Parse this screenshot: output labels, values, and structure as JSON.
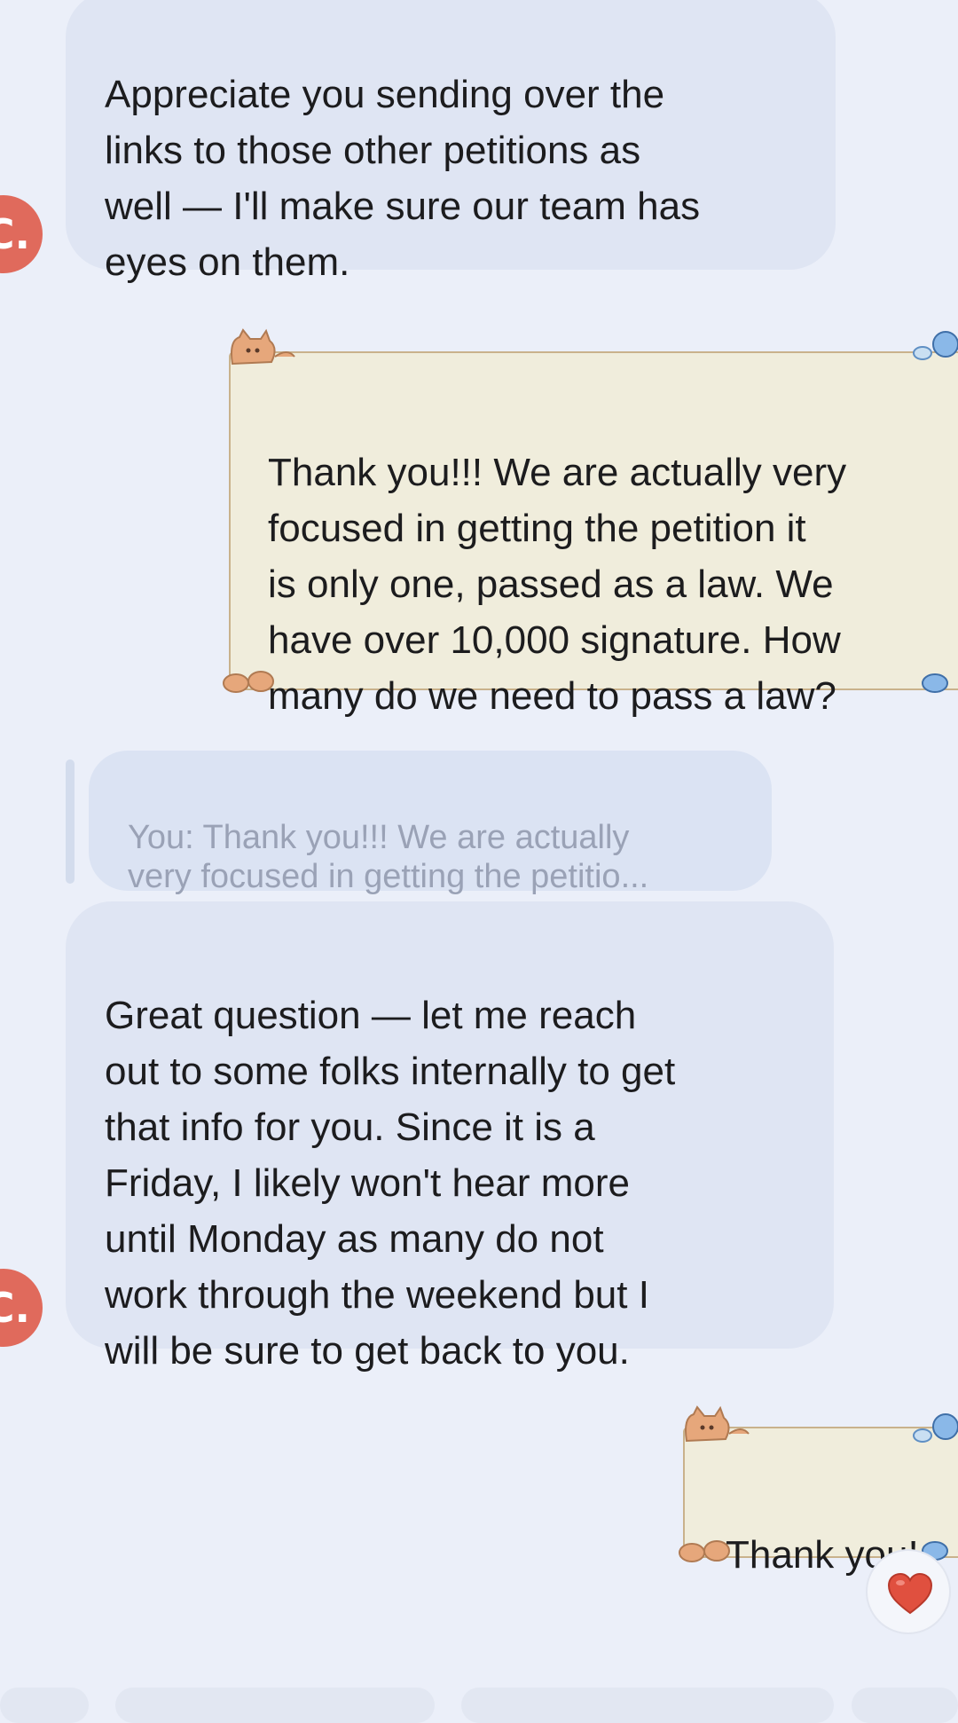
{
  "colors": {
    "background": "#ebeff9",
    "incoming_bubble": "#dfe5f3",
    "outgoing_bubble": "#f0eddc",
    "outgoing_border": "#c9b28c",
    "avatar": "#e06a5c",
    "quote_text": "#9aa2b6",
    "heart": "#e0503f"
  },
  "messages": [
    {
      "direction": "incoming",
      "avatar_letter": "C.",
      "text": "Appreciate you sending over the\nlinks to those other petitions as\nwell — I'll make sure our team has\neyes on them."
    },
    {
      "direction": "outgoing",
      "theme": "cat-sticker-frame",
      "text": "Thank you!!! We are actually very\nfocused in getting the petition it\nis only one, passed as a law. We\nhave over 10,000 signature. How\nmany do we need to pass a law?"
    },
    {
      "direction": "incoming",
      "avatar_letter": "C.",
      "reply_quote": "You: Thank you!!! We are actually\nvery focused in getting the petitio...",
      "text": "Great question — let me reach\nout to some folks internally to get\nthat info for you. Since it is a\nFriday, I likely won't hear more\nuntil Monday as many do not\nwork through the weekend but I\nwill be sure to get back to you."
    },
    {
      "direction": "outgoing",
      "theme": "cat-sticker-frame",
      "text": "Thank you!",
      "reaction_icon": "heart-icon"
    }
  ]
}
